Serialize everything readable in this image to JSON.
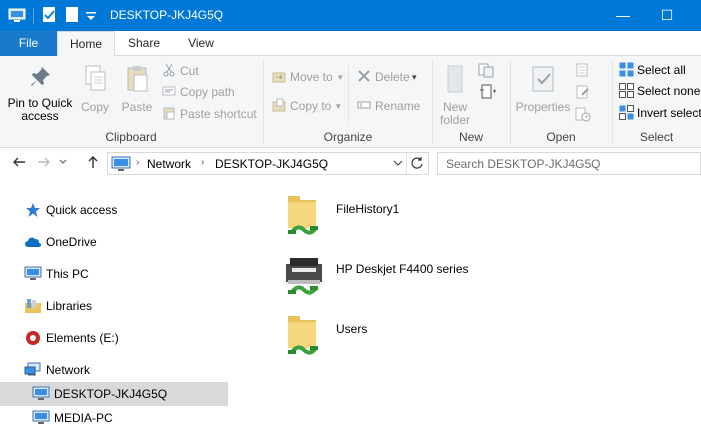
{
  "window": {
    "title": "DESKTOP-JKJ4G5Q",
    "minimize": "—",
    "maximize": "☐"
  },
  "tabs": {
    "file": "File",
    "home": "Home",
    "share": "Share",
    "view": "View"
  },
  "ribbon": {
    "clipboard": {
      "group": "Clipboard",
      "pin_line1": "Pin to Quick",
      "pin_line2": "access",
      "copy": "Copy",
      "paste": "Paste",
      "cut": "Cut",
      "copy_path": "Copy path",
      "paste_shortcut": "Paste shortcut"
    },
    "organize": {
      "group": "Organize",
      "move_to": "Move to",
      "copy_to": "Copy to",
      "delete": "Delete",
      "rename": "Rename"
    },
    "new": {
      "group": "New",
      "new_folder_line1": "New",
      "new_folder_line2": "folder"
    },
    "open": {
      "group": "Open",
      "properties": "Properties"
    },
    "select": {
      "group": "Select",
      "select_all": "Select all",
      "select_none": "Select none",
      "invert_selection": "Invert selecti"
    }
  },
  "address": {
    "crumb_network": "Network",
    "crumb_computer": "DESKTOP-JKJ4G5Q"
  },
  "search": {
    "placeholder": "Search DESKTOP-JKJ4G5Q"
  },
  "nav": {
    "quick_access": "Quick access",
    "onedrive": "OneDrive",
    "this_pc": "This PC",
    "libraries": "Libraries",
    "elements": "Elements (E:)",
    "network": "Network",
    "desktop": "DESKTOP-JKJ4G5Q",
    "media_pc": "MEDIA-PC"
  },
  "content": {
    "items": [
      {
        "name": "FileHistory1",
        "icon": "shared-folder-icon"
      },
      {
        "name": "HP Deskjet F4400 series",
        "icon": "shared-printer-icon"
      },
      {
        "name": "Users",
        "icon": "shared-folder-icon"
      }
    ]
  },
  "colors": {
    "titlebar": "#0078d7",
    "file_tab": "#1979ca",
    "ribbon_bg": "#f5f6f7",
    "selected_nav": "#d9d9d9"
  }
}
